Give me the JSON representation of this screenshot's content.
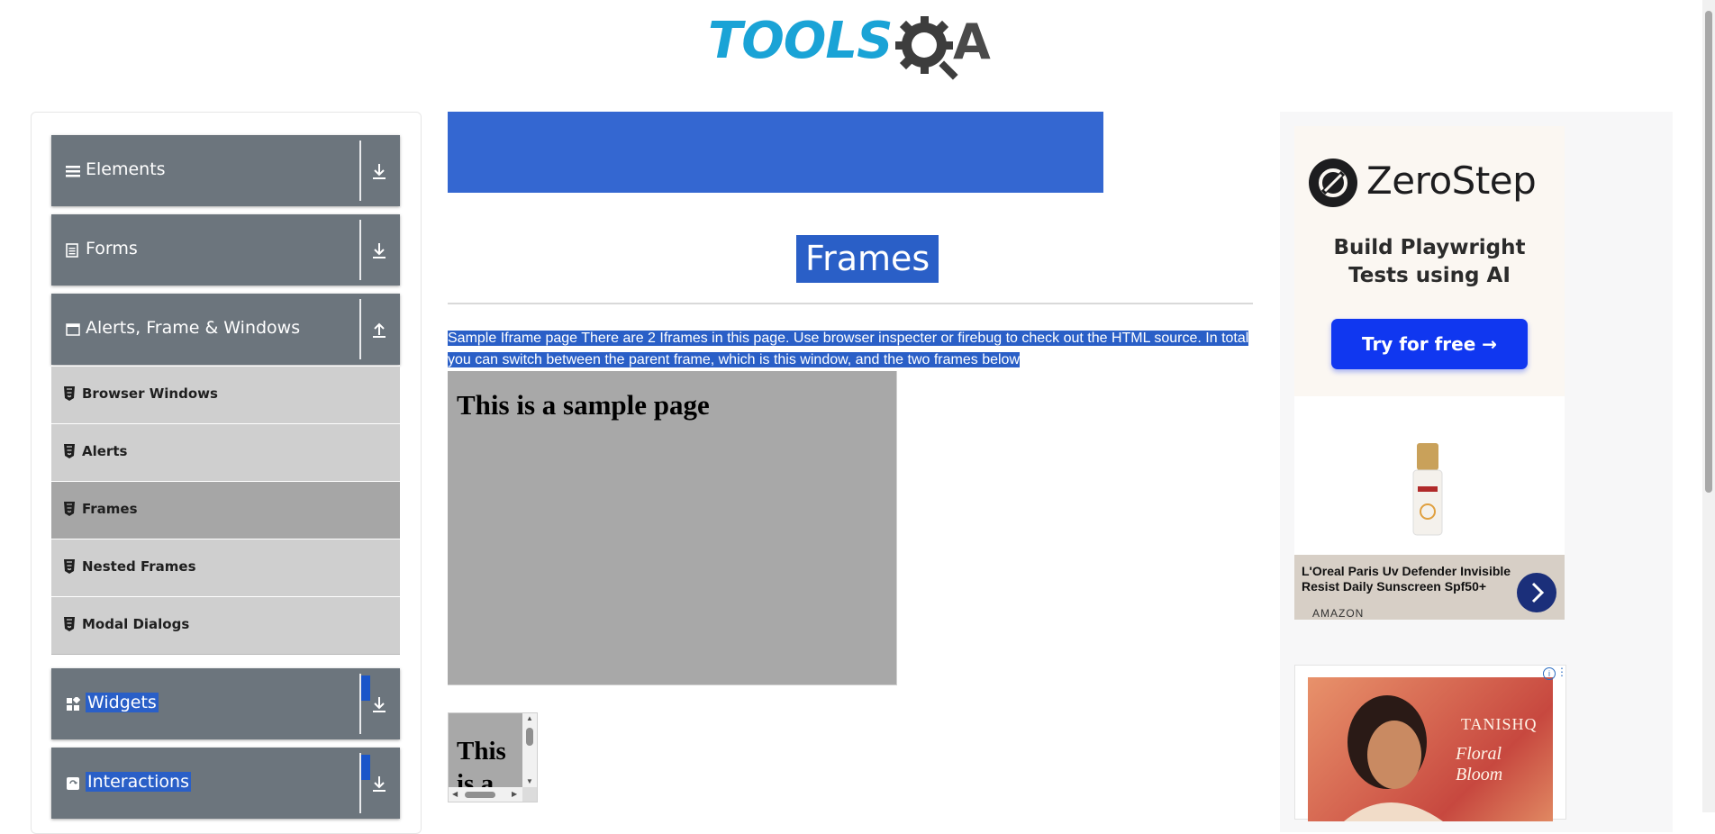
{
  "header": {
    "logo_text": "TOOLS",
    "logo_suffix": "A"
  },
  "sidebar": {
    "groups": [
      {
        "label": "Elements",
        "icon": "hamburger-icon",
        "arrow": "download"
      },
      {
        "label": "Forms",
        "icon": "document-icon",
        "arrow": "download"
      },
      {
        "label": "Alerts, Frame & Windows",
        "icon": "window-icon",
        "arrow": "upload"
      },
      {
        "label": "Widgets",
        "icon": "widgets-icon",
        "arrow": "download"
      },
      {
        "label": "Interactions",
        "icon": "interactions-icon",
        "arrow": "download"
      }
    ],
    "items": [
      {
        "label": "Browser Windows"
      },
      {
        "label": "Alerts"
      },
      {
        "label": "Frames",
        "active": true
      },
      {
        "label": "Nested Frames"
      },
      {
        "label": "Modal Dialogs"
      }
    ]
  },
  "main": {
    "title": "Frames",
    "description": "Sample Iframe page There are 2 Iframes in this page. Use browser inspecter or firebug to check out the HTML source. In total you can switch between the parent frame, which is this window, and the two frames below",
    "frame1_heading": "This is a sample page",
    "frame2_heading": "This is a"
  },
  "ads": {
    "zerostep": {
      "brand": "ZeroStep",
      "tagline_line1": "Build Playwright",
      "tagline_line2": "Tests using AI",
      "button": "Try for free →"
    },
    "loreal": {
      "title": "L'Oreal Paris Uv Defender Invisible Resist Daily Sunscreen Spf50+",
      "source": "AMAZON"
    },
    "tanishq": {
      "brand": "TANISHQ",
      "collection": "Floral Bloom"
    }
  },
  "colors": {
    "group_bg": "#6c757d",
    "item_bg": "#cfcfcf",
    "item_active_bg": "#a6a6a6",
    "banner": "#3467d1",
    "selection": "#2a5fc7",
    "logo_blue": "#1aa3d6"
  }
}
